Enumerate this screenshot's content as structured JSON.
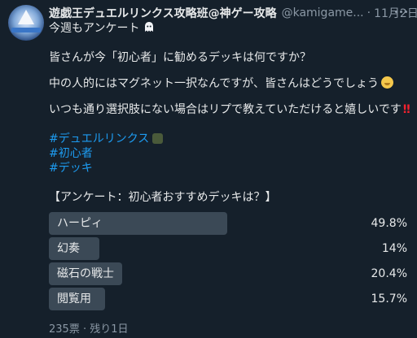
{
  "tweet": {
    "display_name": "遊戯王デュエルリンクス攻略班@神ゲー攻略",
    "handle": "@kamigame...",
    "separator": "·",
    "date": "11月2日",
    "lines": [
      "今週もアンケート",
      "皆さんが今「初心者」に勧めるデッキは何ですか？",
      "中の人的にはマグネット一択なんですが、皆さんはどうでしょう",
      "いつも通り選択肢にない場合はリプで教えていただけると嬉しいです"
    ],
    "bangs": "‼",
    "hashtags": [
      "#デュエルリンクス",
      "#初心者",
      "#デッキ"
    ],
    "poll_title": "【アンケート：初心者おすすめデッキは？】"
  },
  "poll": {
    "options": [
      {
        "label": "ハーピィ",
        "percent_text": "49.8%",
        "share": 0.498
      },
      {
        "label": "幻奏",
        "percent_text": "14%",
        "share": 0.14
      },
      {
        "label": "磁石の戦士",
        "percent_text": "20.4%",
        "share": 0.204
      },
      {
        "label": "閲覧用",
        "percent_text": "15.7%",
        "share": 0.157
      }
    ],
    "footer": "235票 · 残り1日"
  },
  "colors": {
    "background": "#15202b",
    "text": "#e7e9ea",
    "muted": "#8b98a5",
    "link": "#1d9bf0",
    "poll_bar": "#3b4956",
    "alert": "#f4212e"
  },
  "icons": [
    "avatar",
    "ghost-emoji-icon",
    "face-emoji-icon",
    "card-emoji-icon",
    "more-icon"
  ]
}
